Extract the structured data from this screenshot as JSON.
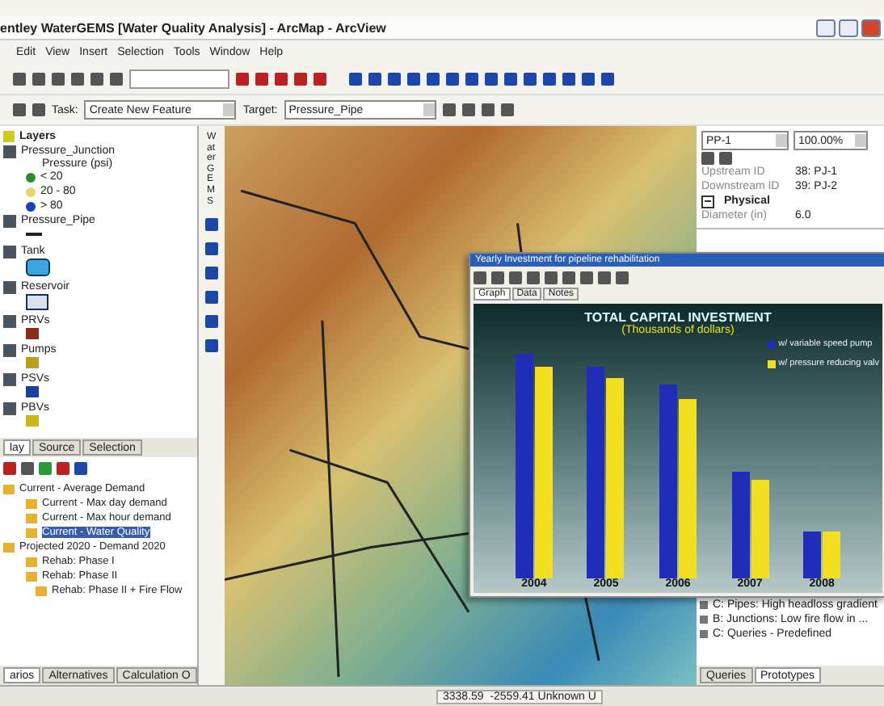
{
  "window": {
    "title": "entley WaterGEMS [Water Quality Analysis] - ArcMap - ArcView"
  },
  "menu": [
    "Edit",
    "View",
    "Insert",
    "Selection",
    "Tools",
    "Window",
    "Help"
  ],
  "editor": {
    "task_label": "Task:",
    "task": "Create New Feature",
    "target_label": "Target:",
    "target": "Pressure_Pipe"
  },
  "layers": {
    "title": "Layers",
    "items": [
      {
        "name": "Pressure_Junction",
        "checked": true,
        "kind": "classes",
        "legend_title": "Pressure (psi)",
        "classes": [
          {
            "label": "< 20",
            "color": "#2e8b2e"
          },
          {
            "label": "20 - 80",
            "color": "#e8d86a"
          },
          {
            "label": "> 80",
            "color": "#1a3fc0"
          }
        ]
      },
      {
        "name": "Pressure_Pipe",
        "checked": true,
        "kind": "line"
      },
      {
        "name": "Tank",
        "checked": true,
        "kind": "tank"
      },
      {
        "name": "Reservoir",
        "checked": true,
        "kind": "reservoir"
      },
      {
        "name": "PRVs",
        "checked": true,
        "kind": "symbol",
        "color": "#8a2a1a"
      },
      {
        "name": "Pumps",
        "checked": true,
        "kind": "symbol",
        "color": "#b8a020"
      },
      {
        "name": "PSVs",
        "checked": true,
        "kind": "symbol",
        "color": "#1a3f9a"
      },
      {
        "name": "PBVs",
        "checked": true,
        "kind": "symbol",
        "color": "#c8b818"
      }
    ]
  },
  "toc_tabs": [
    {
      "label": "lay",
      "selected": true
    },
    {
      "label": "Source",
      "selected": false
    },
    {
      "label": "Selection",
      "selected": false
    }
  ],
  "side_strip": "WaterGEMS",
  "scenarios": {
    "items": [
      {
        "label": "Current - Average Demand",
        "selected": false,
        "children": [
          {
            "label": "Current - Max day demand",
            "selected": false
          },
          {
            "label": "Current - Max hour demand",
            "selected": false
          },
          {
            "label": "Current - Water Quality",
            "selected": true
          }
        ]
      },
      {
        "label": "Projected 2020 - Demand 2020",
        "selected": false,
        "children": [
          {
            "label": "Rehab: Phase I",
            "selected": false
          },
          {
            "label": "Rehab: Phase II",
            "selected": false,
            "children": [
              {
                "label": "Rehab: Phase II + Fire Flow",
                "selected": false
              }
            ]
          }
        ]
      }
    ],
    "tabs": [
      {
        "label": "arios",
        "selected": true
      },
      {
        "label": "Alternatives",
        "selected": false
      },
      {
        "label": "Calculation O",
        "selected": false
      }
    ]
  },
  "properties": {
    "element": "PP-1",
    "zoom": "100.00%",
    "rows": [
      {
        "kind": "field",
        "label": "Upstream ID",
        "value": "38: PJ-1"
      },
      {
        "kind": "field",
        "label": "Downstream ID",
        "value": "39: PJ-2"
      },
      {
        "kind": "section",
        "label": "Physical",
        "expanded": true
      },
      {
        "kind": "field",
        "label": "Diameter (in)",
        "value": "6.0"
      }
    ]
  },
  "graph_window": {
    "title": "Yearly Investment for pipeline rehabilitation",
    "tabs": [
      {
        "label": "Graph",
        "selected": true
      },
      {
        "label": "Data",
        "selected": false
      },
      {
        "label": "Notes",
        "selected": false
      }
    ],
    "chart_title": "TOTAL CAPITAL INVESTMENT",
    "chart_subtitle": "(Thousands of dollars)",
    "series": [
      {
        "name": "w/ variable speed pump",
        "color": "#1f2db8"
      },
      {
        "name": "w/ pressure reducing valv",
        "color": "#f2e020"
      }
    ],
    "years": [
      "2004",
      "2005",
      "2006",
      "2007",
      "2008"
    ]
  },
  "queries": {
    "items": [
      {
        "label": "C: Pipes: High headloss gradient"
      },
      {
        "label": "B: Junctions: Low fire flow in ..."
      },
      {
        "label": "C: Queries - Predefined"
      }
    ],
    "tabs": [
      {
        "label": "Queries",
        "selected": false
      },
      {
        "label": "Prototypes",
        "selected": true
      }
    ]
  },
  "status_bar": "3338.59  -2559.41 Unknown U"
}
